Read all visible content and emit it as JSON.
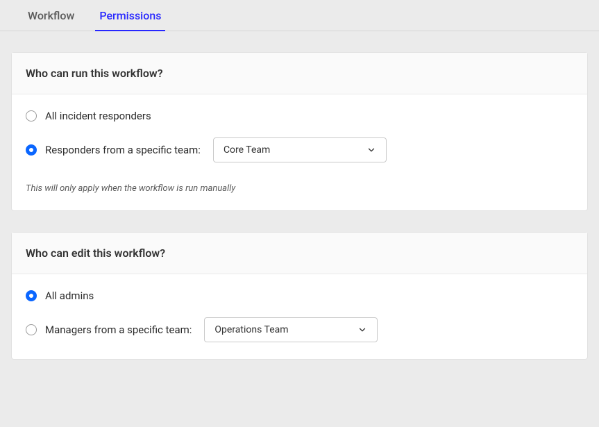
{
  "tabs": {
    "workflow": "Workflow",
    "permissions": "Permissions",
    "active": "permissions"
  },
  "run_section": {
    "title": "Who can run this workflow?",
    "option_all": "All incident responders",
    "option_team": "Responders from a specific team:",
    "selected": "team",
    "team_selected": "Core Team",
    "hint": "This will only apply when the workflow is run manually"
  },
  "edit_section": {
    "title": "Who can edit this workflow?",
    "option_all": "All admins",
    "option_team": "Managers from a specific team:",
    "selected": "all",
    "team_selected": "Operations Team"
  }
}
